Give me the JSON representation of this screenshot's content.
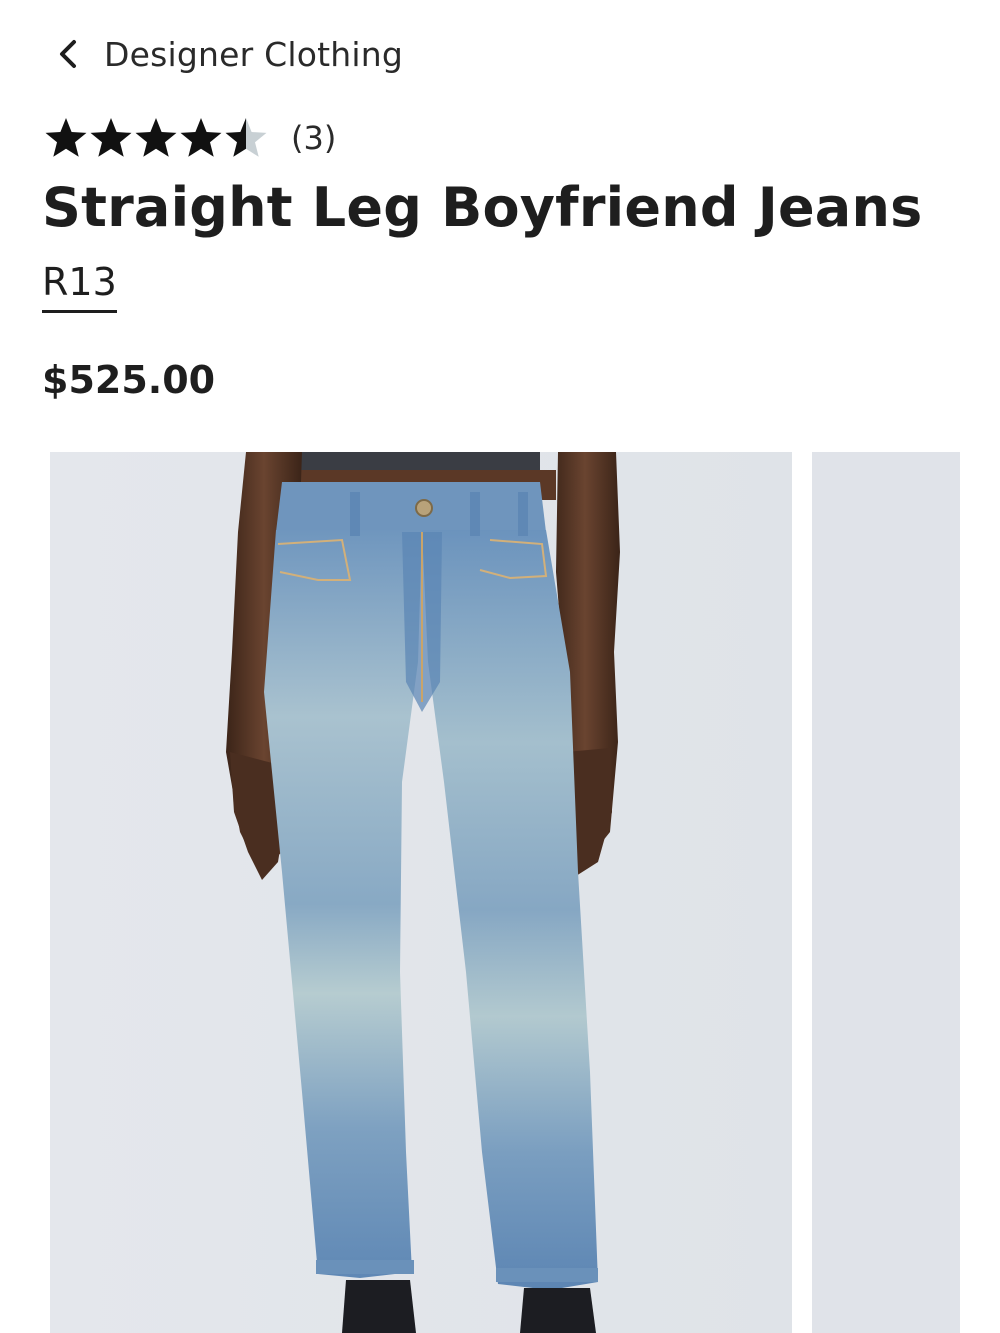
{
  "nav": {
    "back_label": "Designer Clothing",
    "back_icon": "chevron-left-icon"
  },
  "product": {
    "rating_value": 4.5,
    "rating_max": 5,
    "rating_count": "(3)",
    "title": "Straight Leg Boyfriend Jeans",
    "brand": "R13",
    "price": "$525.00"
  },
  "colors": {
    "text": "#1e1e1e",
    "star_filled": "#111111",
    "star_empty": "#c8d0d4",
    "photo_background": "#e2e5ea",
    "denim": "#7fa2c4"
  },
  "gallery": {
    "main_image": "model-wearing-light-wash-straight-leg-jeans",
    "next_image": "next-product-image-peek"
  }
}
